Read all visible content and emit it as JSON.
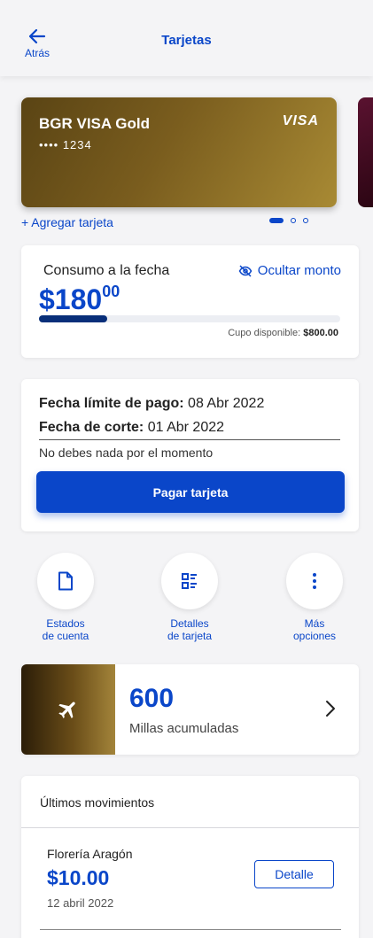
{
  "header": {
    "back_label": "Atrás",
    "title": "Tarjetas"
  },
  "card": {
    "name": "BGR VISA Gold",
    "number": "•••• 1234",
    "brand": "VISA"
  },
  "add_card": "+ Agregar tarjeta",
  "carousel": {
    "count": 3,
    "active": 1
  },
  "consumption": {
    "label": "Consumo a la fecha",
    "hide_label": "Ocultar monto",
    "amount_main": "$180",
    "amount_cents": "00",
    "used_fraction": 0.225,
    "available_label": "Cupo disponible: ",
    "available_value": "$800.00"
  },
  "payment": {
    "due_label": "Fecha límite de pago:",
    "due_value": " 08 Abr 2022",
    "cut_label": "Fecha de corte:",
    "cut_value": " 01 Abr 2022",
    "note": "No debes nada por el momento",
    "pay_button": "Pagar tarjeta"
  },
  "actions": [
    {
      "line1": "Estados",
      "line2": "de cuenta",
      "icon": "document-icon"
    },
    {
      "line1": "Detalles",
      "line2": "de tarjeta",
      "icon": "details-list-icon"
    },
    {
      "line1": "Más",
      "line2": "opciones",
      "icon": "more-vertical-icon"
    }
  ],
  "miles": {
    "value": "600",
    "label": "Millas acumuladas",
    "icon": "airplane-icon"
  },
  "movements": {
    "title": "Últimos movimientos",
    "items": [
      {
        "merchant": "Florería Aragón",
        "amount": "$10.00",
        "date": "12 abril 2022",
        "button": "Detalle"
      }
    ]
  },
  "colors": {
    "accent": "#0a46c9",
    "bar_fill": "#082f7a",
    "background": "#f4f4f6"
  }
}
